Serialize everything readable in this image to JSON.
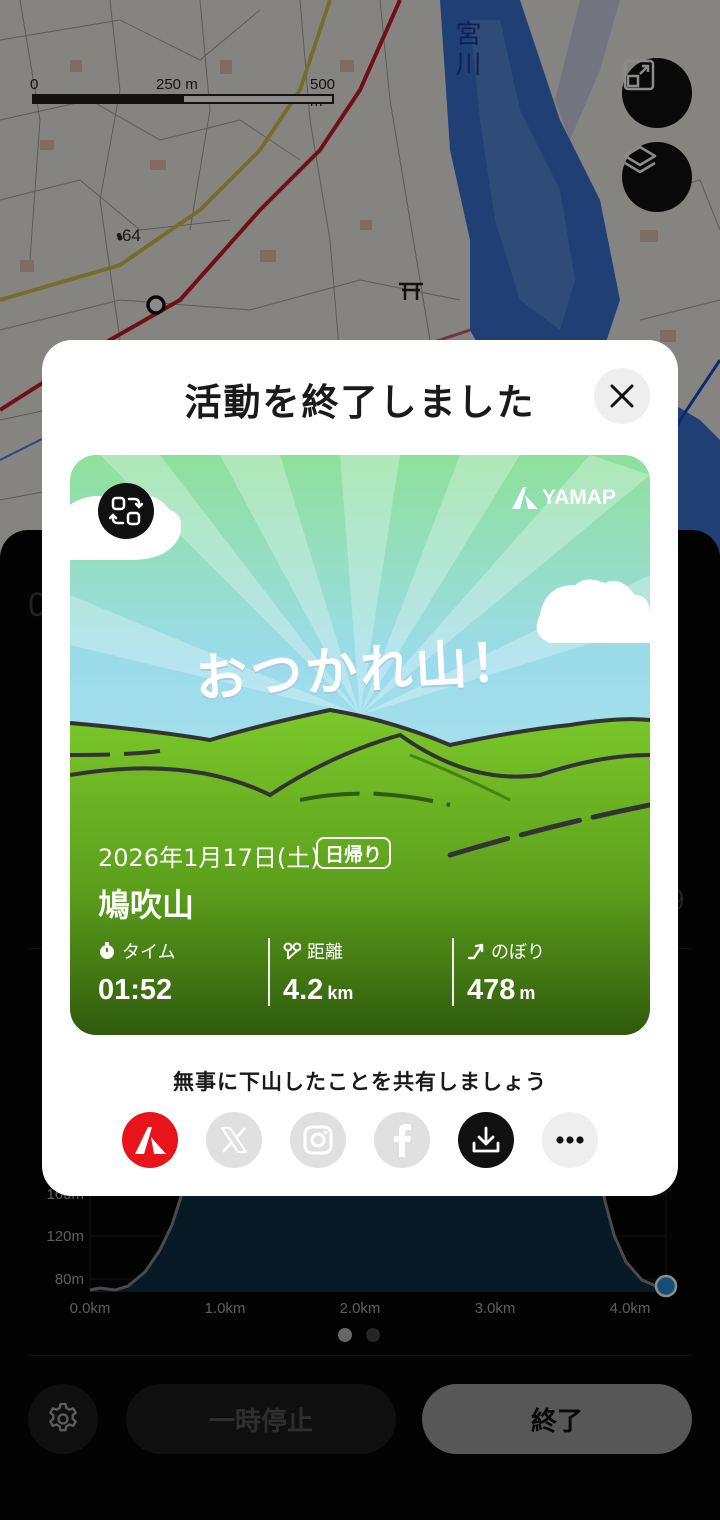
{
  "map": {
    "scale_labels": [
      "0",
      "250 m",
      "500 m"
    ],
    "elevation_point": "•64",
    "river_label": "宮川",
    "buttons": [
      "fit-route-icon",
      "layers-icon"
    ]
  },
  "sheet": {
    "peek_left": "0",
    "peek_right_mid": "9"
  },
  "elevation_chart": {
    "y_labels": [
      "160m",
      "120m",
      "80m"
    ],
    "x_labels": [
      "0.0km",
      "1.0km",
      "2.0km",
      "3.0km",
      "4.0km"
    ],
    "line_color": "#888888",
    "fill_color": "#0c2f44",
    "marker_color": "#2f8fd4"
  },
  "pager": {
    "count": 2,
    "active": 0
  },
  "controls": {
    "pause_label": "一時停止",
    "end_label": "終了"
  },
  "modal": {
    "title": "活動を終了しました",
    "card": {
      "brand": "YAMAP",
      "headline": "おつかれ山！",
      "date": "2026年1月17日(土)",
      "trip_type": "日帰り",
      "mountain": "鳩吹山",
      "stats": [
        {
          "icon": "stopwatch-icon",
          "label": "タイム",
          "value": "01:52",
          "unit": ""
        },
        {
          "icon": "distance-pin-icon",
          "label": "距離",
          "value": "4.2",
          "unit": "km"
        },
        {
          "icon": "climb-arrow-icon",
          "label": "のぼり",
          "value": "478",
          "unit": "m"
        }
      ]
    },
    "share_prompt": "無事に下山したことを共有しましょう",
    "share_targets": [
      {
        "name": "yamap",
        "bg": "#e8141c"
      },
      {
        "name": "x",
        "bg": "#e0e0e0"
      },
      {
        "name": "instagram",
        "bg": "#e0e0e0"
      },
      {
        "name": "facebook",
        "bg": "#e0e0e0"
      },
      {
        "name": "download",
        "bg": "#111111"
      },
      {
        "name": "more",
        "bg": "#eeeeee"
      }
    ]
  }
}
